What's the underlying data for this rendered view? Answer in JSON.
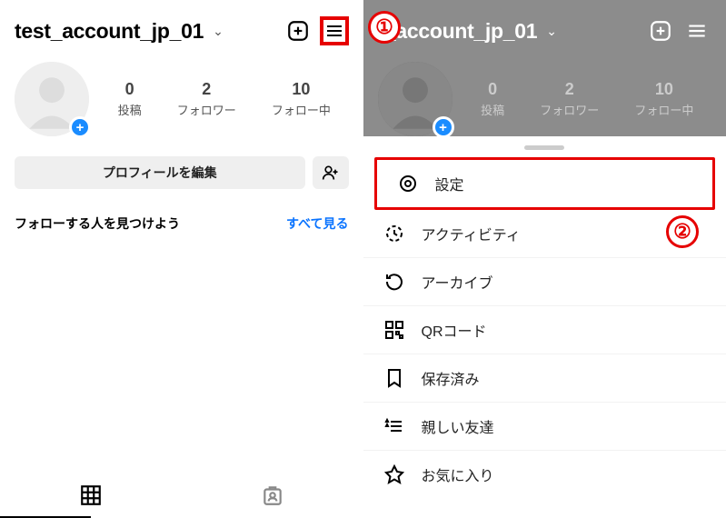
{
  "username": "test_account_jp_01",
  "stats": {
    "posts": {
      "count": "0",
      "label": "投稿"
    },
    "followers": {
      "count": "2",
      "label": "フォロワー"
    },
    "following": {
      "count": "10",
      "label": "フォロー中"
    }
  },
  "buttons": {
    "edit_profile": "プロフィールを編集"
  },
  "discover": {
    "title": "フォローする人を見つけよう",
    "see_all": "すべて見る"
  },
  "right": {
    "username_partial": "t_account_jp_01"
  },
  "menu": {
    "settings": "設定",
    "activity": "アクティビティ",
    "archive": "アーカイブ",
    "qr": "QRコード",
    "saved": "保存済み",
    "close_friends": "親しい友達",
    "favorites": "お気に入り"
  },
  "callouts": {
    "one": "①",
    "two": "②"
  }
}
